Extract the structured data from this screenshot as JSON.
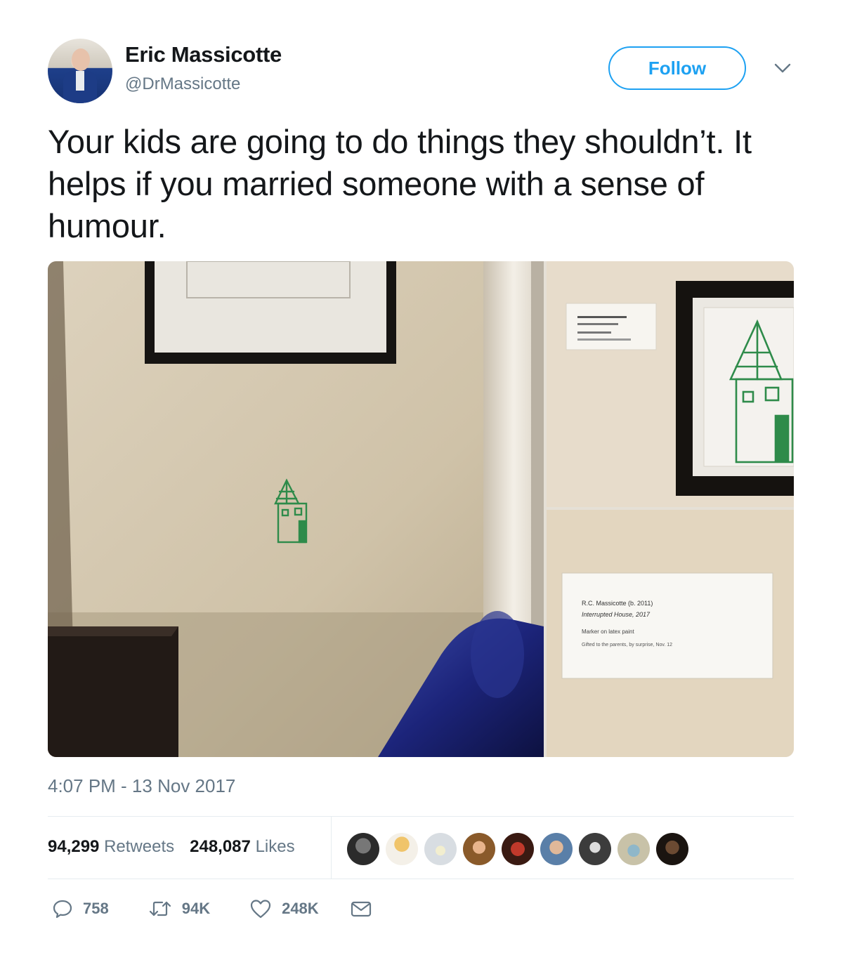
{
  "author": {
    "name": "Eric Massicotte",
    "handle": "@DrMassicotte"
  },
  "follow_label": "Follow",
  "tweet_text": "Your kids are going to do things they shouldn’t. It helps if you married someone with a sense of humour.",
  "timestamp": "4:07 PM - 13 Nov 2017",
  "stats": {
    "retweets_count": "94,299",
    "retweets_label": "Retweets",
    "likes_count": "248,087",
    "likes_label": "Likes"
  },
  "actions": {
    "replies": "758",
    "retweets": "94K",
    "likes": "248K"
  },
  "placard": {
    "line1": "R.C. Massicotte (b. 2011)",
    "line2": "Interrupted House, 2017",
    "line3": "Marker on latex paint",
    "line4": "Gifted to the parents, by surprise, Nov. 12"
  },
  "colors": {
    "accent": "#1da1f2",
    "text": "#14171a",
    "muted": "#657786",
    "divider": "#e6ecf0",
    "marker_green": "#2e8b4a"
  },
  "icons": [
    "chevron-down-icon",
    "reply-icon",
    "retweet-icon",
    "heart-icon",
    "message-icon"
  ]
}
